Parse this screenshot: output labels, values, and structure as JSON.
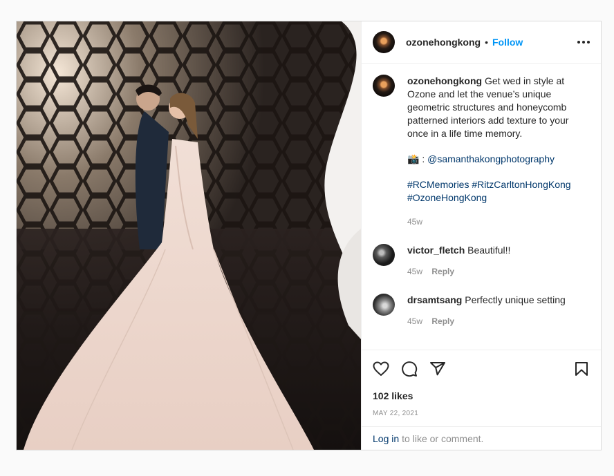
{
  "post": {
    "username": "ozonehongkong",
    "separator": "•",
    "follow_label": "Follow",
    "caption": {
      "username": "ozonehongkong",
      "text": "Get wed in style at Ozone and let the venue’s unique geometric structures and honeycomb patterned interiors add texture to your once in a life time memory.",
      "credit_emoji": "📸",
      "credit_sep": ":",
      "credit_handle": "@samanthakongphotography",
      "hashtags": [
        "#RCMemories",
        "#RitzCarltonHongKong",
        "#OzoneHongKong"
      ],
      "age": "45w"
    },
    "comments": [
      {
        "username": "victor_fletch",
        "text": "Beautiful!!",
        "age": "45w",
        "reply": "Reply"
      },
      {
        "username": "drsamtsang",
        "text": "Perfectly unique setting",
        "age": "45w",
        "reply": "Reply"
      }
    ],
    "likes": "102 likes",
    "date": "MAY 22, 2021",
    "login_link": "Log in",
    "login_text": "to like or comment."
  },
  "icons": {
    "like": "heart-icon",
    "comment": "comment-bubble-icon",
    "share": "paper-plane-icon",
    "save": "bookmark-icon",
    "more": "more-options-icon"
  },
  "colors": {
    "follow": "#0095f6",
    "link": "#00376b",
    "muted": "#8e8e8e",
    "border": "#dbdbdb"
  }
}
